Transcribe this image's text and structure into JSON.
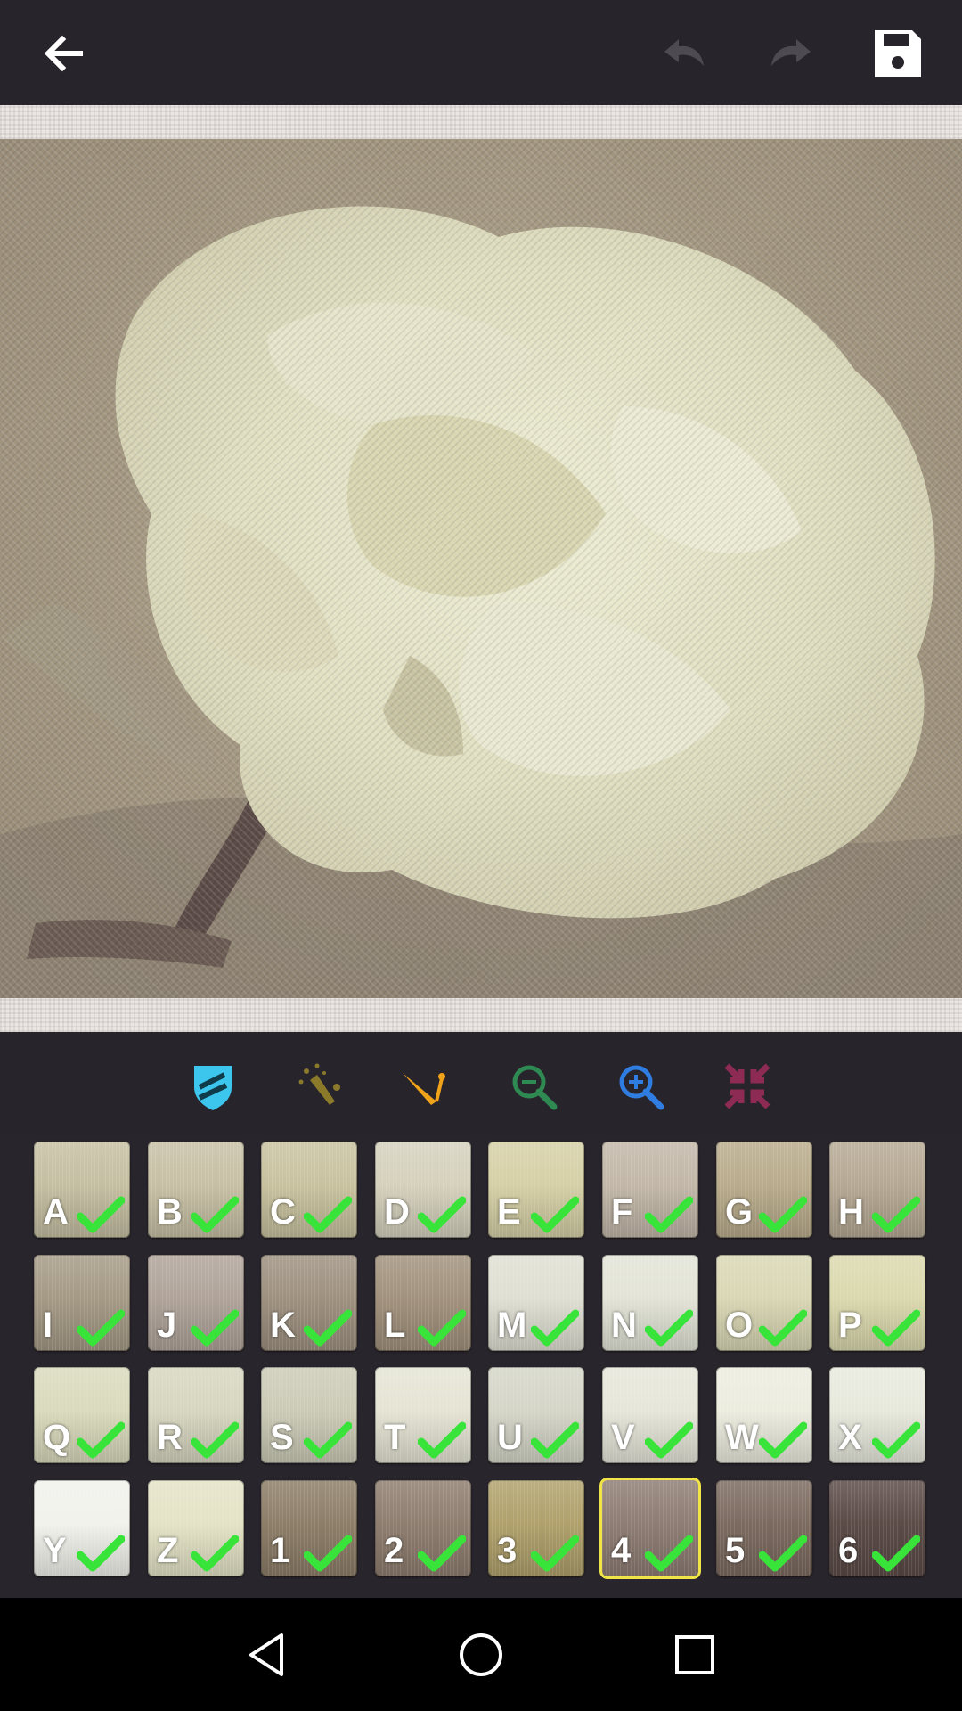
{
  "toolbar": {
    "back_icon": "arrow-left-icon",
    "undo_icon": "undo-icon",
    "redo_icon": "redo-icon",
    "save_icon": "save-disk-icon"
  },
  "tools": [
    {
      "name": "shield-tool",
      "icon": "shield-icon",
      "color": "#3cc6ee"
    },
    {
      "name": "magic-wand-tool",
      "icon": "magic-wand-icon",
      "color": "#8a7a2a"
    },
    {
      "name": "needle-tool",
      "icon": "needle-icon",
      "color": "#f0a21a"
    },
    {
      "name": "zoom-out-tool",
      "icon": "zoom-out-icon",
      "color": "#2e8a52"
    },
    {
      "name": "zoom-in-tool",
      "icon": "zoom-in-icon",
      "color": "#2f7de0"
    },
    {
      "name": "fit-screen-tool",
      "icon": "compress-arrows-icon",
      "color": "#8e2b54"
    }
  ],
  "palette": [
    {
      "label": "A",
      "color": "#c5bfa2",
      "done": true
    },
    {
      "label": "B",
      "color": "#c7c0a5",
      "done": true
    },
    {
      "label": "C",
      "color": "#c8c29f",
      "done": true
    },
    {
      "label": "D",
      "color": "#d5d1bd",
      "done": true
    },
    {
      "label": "E",
      "color": "#d5d0a6",
      "done": true
    },
    {
      "label": "F",
      "color": "#c2b7a8",
      "done": true
    },
    {
      "label": "G",
      "color": "#b9ac8c",
      "done": true
    },
    {
      "label": "H",
      "color": "#b6a994",
      "done": true
    },
    {
      "label": "I",
      "color": "#a59a86",
      "done": true
    },
    {
      "label": "J",
      "color": "#b0a49a",
      "done": true
    },
    {
      "label": "K",
      "color": "#9e9180",
      "done": true
    },
    {
      "label": "L",
      "color": "#a2927d",
      "done": true
    },
    {
      "label": "M",
      "color": "#e0dfd3",
      "done": true
    },
    {
      "label": "N",
      "color": "#e3e4d7",
      "done": true
    },
    {
      "label": "O",
      "color": "#d9d7b4",
      "done": true
    },
    {
      "label": "P",
      "color": "#dbd9ae",
      "done": true
    },
    {
      "label": "Q",
      "color": "#dadabd",
      "done": true
    },
    {
      "label": "R",
      "color": "#d7d6c0",
      "done": true
    },
    {
      "label": "S",
      "color": "#cccbb7",
      "done": true
    },
    {
      "label": "T",
      "color": "#e5e4d4",
      "done": true
    },
    {
      "label": "U",
      "color": "#d5d6c8",
      "done": true
    },
    {
      "label": "V",
      "color": "#e6e6da",
      "done": true
    },
    {
      "label": "W",
      "color": "#ececdf",
      "done": true
    },
    {
      "label": "X",
      "color": "#e8e9dd",
      "done": true
    },
    {
      "label": "Y",
      "color": "#f2f2ec",
      "done": true
    },
    {
      "label": "Z",
      "color": "#e4e3c6",
      "done": true
    },
    {
      "label": "1",
      "color": "#8d7e68",
      "done": true
    },
    {
      "label": "2",
      "color": "#8f7e70",
      "done": true
    },
    {
      "label": "3",
      "color": "#b0a16c",
      "done": true
    },
    {
      "label": "4",
      "color": "#8e7d74",
      "done": true,
      "selected": true
    },
    {
      "label": "5",
      "color": "#7c6b60",
      "done": true
    },
    {
      "label": "6",
      "color": "#5c4c48",
      "done": true
    }
  ],
  "nav": {
    "back_icon": "nav-back-triangle-icon",
    "home_icon": "nav-home-circle-icon",
    "recents_icon": "nav-recents-square-icon"
  }
}
